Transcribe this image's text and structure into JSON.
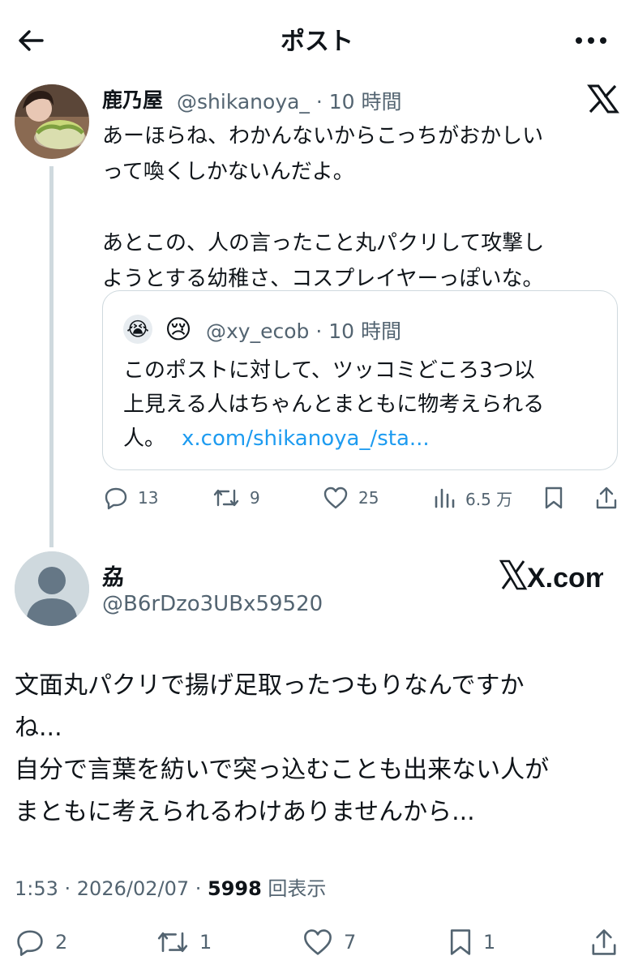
{
  "header": {
    "title": "ポスト"
  },
  "post1": {
    "name": "鹿乃屋",
    "handle_time": "@shikanoya_ · 10 時間",
    "text": "あーほらね、わかんないからこっちがおかしい\nって喚くしかないんだよ。\n\nあとこの、人の言ったこと丸パクリして攻撃し\nようとする幼稚さ、コスプレイヤーっぽいな。",
    "quote": {
      "avatar_emoji_1": "😭",
      "avatar_emoji_2": "😢",
      "handle_time": "@xy_ecob · 10 時間",
      "text_line1": "このポストに対して、ツッコミどころ3つ以",
      "text_line2": "上見える人はちゃんとまともに物考えられる",
      "text_line3": "人。",
      "link": "x.com/shikanoya_/sta..."
    },
    "stats": {
      "replies": "13",
      "reposts": "9",
      "likes": "25",
      "views": "6.5 万"
    }
  },
  "post2": {
    "name": "劦",
    "handle": "@B6rDzo3UBx59520",
    "watermark": "X.com",
    "text": "文面丸パクリで揚げ足取ったつもりなんですか\nね...\n自分で言葉を紡いで突っ込むことも出来ない人が\nまともに考えられるわけありませんから...",
    "meta_time": "1:53 · 2026/02/07 · ",
    "views_count": "5998",
    "views_label": " 回表示",
    "stats": {
      "replies": "2",
      "reposts": "1",
      "likes": "7",
      "bookmarks": "1"
    }
  },
  "colors": {
    "accent": "#1d9bf0",
    "muted": "#536471",
    "border": "#cfd9de",
    "text": "#0f1419"
  },
  "icons": [
    "back-arrow-icon",
    "more-icon",
    "x-logo-icon",
    "reply-icon",
    "repost-icon",
    "like-icon",
    "views-icon",
    "bookmark-icon",
    "share-icon"
  ]
}
